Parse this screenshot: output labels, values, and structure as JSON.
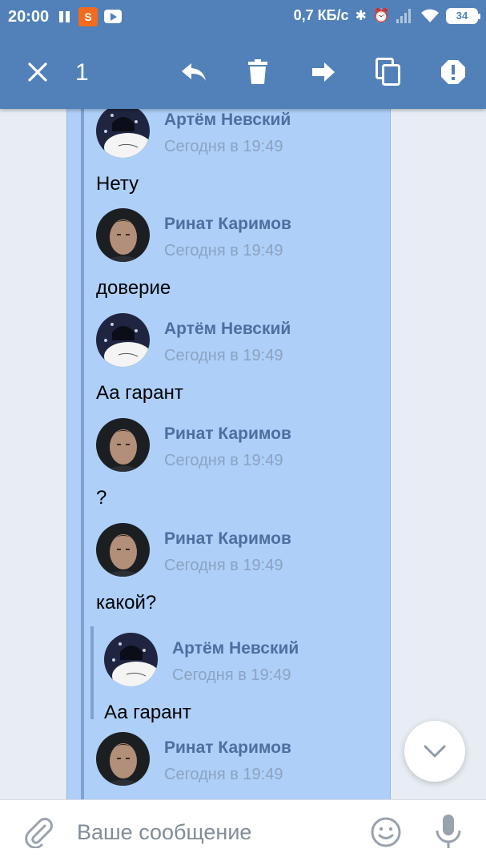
{
  "status_bar": {
    "time": "20:00",
    "app_icon_letter": "S",
    "speed": "0,7 КБ/с",
    "battery": "34"
  },
  "toolbar": {
    "selected_count": "1",
    "icons": [
      "close-icon",
      "reply-icon",
      "delete-icon",
      "forward-icon",
      "copy-icon",
      "report-icon"
    ]
  },
  "messages": [
    {
      "author": "Артём Невский",
      "time": "Сегодня в 19:49",
      "text": "Нету"
    },
    {
      "author": "Ринат Каримов",
      "time": "Сегодня в 19:49",
      "text": "доверие"
    },
    {
      "author": "Артём Невский",
      "time": "Сегодня в 19:49",
      "text": "Аа гарант"
    },
    {
      "author": "Ринат Каримов",
      "time": "Сегодня в 19:49",
      "text": "?"
    },
    {
      "author": "Ринат Каримов",
      "time": "Сегодня в 19:49",
      "text": "какой?"
    },
    {
      "author": "Артём Невский",
      "time": "Сегодня в 19:49",
      "text": "Аа гарант"
    },
    {
      "author": "Ринат Каримов",
      "time": "Сегодня в 19:49",
      "text": ""
    }
  ],
  "composer": {
    "placeholder": "Ваше сообщение"
  },
  "colors": {
    "header": "#5181b8",
    "selected_bubble": "#adcff8",
    "author": "#4c6f9f",
    "timestamp": "#8ba3c1"
  }
}
